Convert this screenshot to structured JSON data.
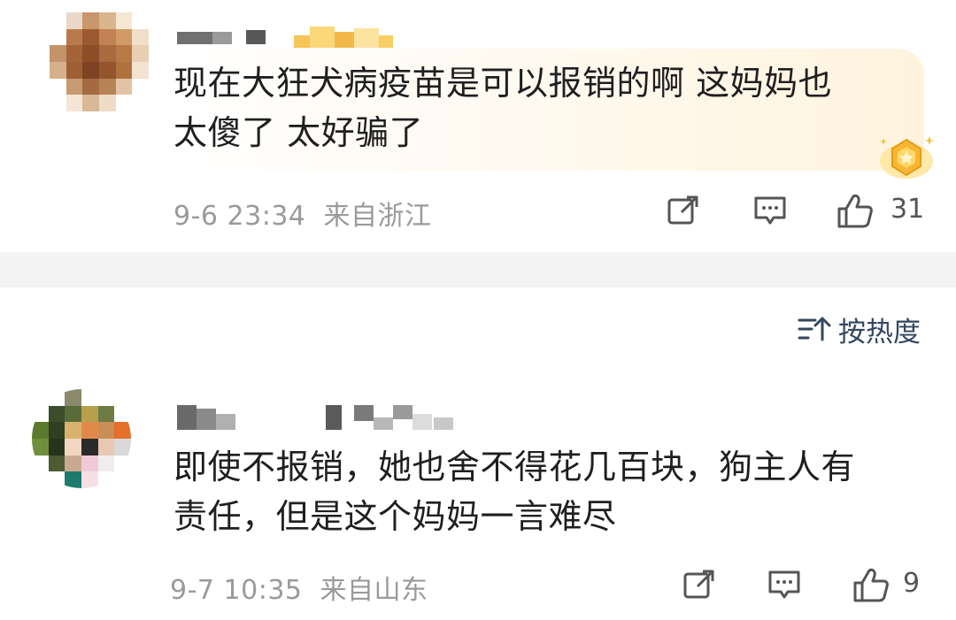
{
  "comments": [
    {
      "text_line1": "现在大狂犬病疫苗是可以报销的啊 这妈妈也",
      "text_line2": "太傻了 太好骗了",
      "time": "9-6 23:34",
      "location": "来自浙江",
      "likes": "31",
      "icons": [
        "share-icon",
        "comment-icon",
        "like-icon"
      ],
      "badge_icon": "gold-badge-icon"
    },
    {
      "text_line1": "即使不报销，她也舍不得花几百块，狗主人有",
      "text_line2": "责任，但是这个妈妈一言难尽",
      "time": "9-7 10:35",
      "location": "来自山东",
      "likes": "9",
      "icons": [
        "share-icon",
        "comment-icon",
        "like-icon"
      ]
    }
  ],
  "sort": {
    "label": "按热度",
    "icon": "sort-icon",
    "color": "#33475f"
  },
  "colors": {
    "bubble_highlight": "#fff3de",
    "meta_text": "#9a9a9a",
    "divider": "#f3f3f3"
  }
}
